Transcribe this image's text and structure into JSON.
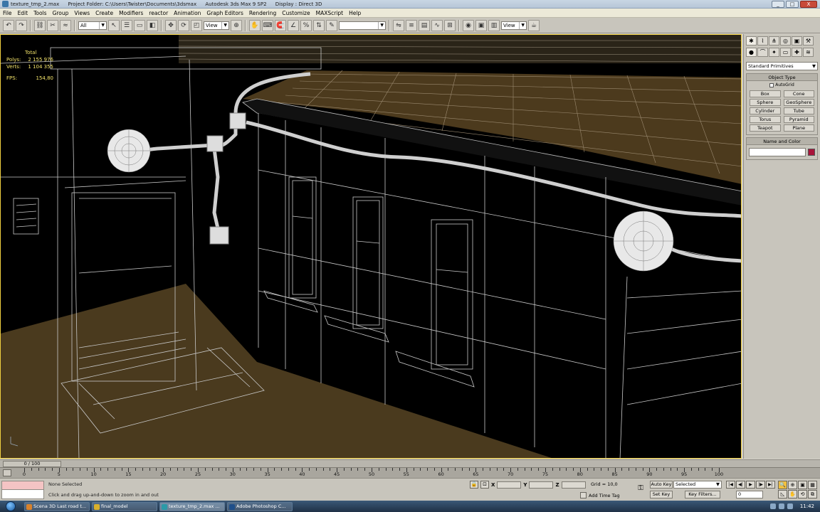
{
  "titlebar": {
    "file": "texture_tmp_2.max",
    "project": "Project Folder: C:\\Users\\Twister\\Documents\\3dsmax",
    "app": "Autodesk 3ds Max 9 SP2",
    "display": "Display : Direct 3D",
    "minimize": "_",
    "maximize": "□",
    "close": "X"
  },
  "menu": [
    "File",
    "Edit",
    "Tools",
    "Group",
    "Views",
    "Create",
    "Modifiers",
    "reactor",
    "Animation",
    "Graph Editors",
    "Rendering",
    "Customize",
    "MAXScript",
    "Help"
  ],
  "toolbar": {
    "selection_filter": "All",
    "ref_coord": "View",
    "named_selection": "",
    "view_dropdown": "View"
  },
  "viewport": {
    "stats": {
      "header": "Total",
      "polys_label": "Polys:",
      "polys_value": "2 155 976",
      "verts_label": "Verts:",
      "verts_value": "1 104 355",
      "fps_label": "FPS:",
      "fps_value": "154,80"
    }
  },
  "command_panel": {
    "category": "Standard Primitives",
    "object_type_header": "Object Type",
    "autogrid": "AutoGrid",
    "buttons": [
      "Box",
      "Cone",
      "Sphere",
      "GeoSphere",
      "Cylinder",
      "Tube",
      "Torus",
      "Pyramid",
      "Teapot",
      "Plane"
    ],
    "name_color_header": "Name and Color",
    "color": "#a8143a"
  },
  "time_slider": {
    "label": "0 / 100"
  },
  "track": {
    "labels": [
      "0",
      "5",
      "10",
      "15",
      "20",
      "25",
      "30",
      "35",
      "40",
      "45",
      "50",
      "55",
      "60",
      "65",
      "70",
      "75",
      "80",
      "85",
      "90",
      "95",
      "100"
    ]
  },
  "status": {
    "selection": "None Selected",
    "prompt": "Click and drag up-and-down to zoom in and out",
    "x_label": "X",
    "y_label": "Y",
    "z_label": "Z",
    "grid": "Grid = 10,0",
    "add_time_tag": "Add Time Tag",
    "auto_key": "Auto Key",
    "set_key": "Set Key",
    "selected": "Selected",
    "key_filters": "Key Filters...",
    "frame": "0"
  },
  "taskbar": {
    "tasks": [
      "Scena 3D Last road t...",
      "final_model",
      "texture_tmp_2.max ...",
      "Adobe Photoshop C..."
    ],
    "clock": "11:42"
  }
}
